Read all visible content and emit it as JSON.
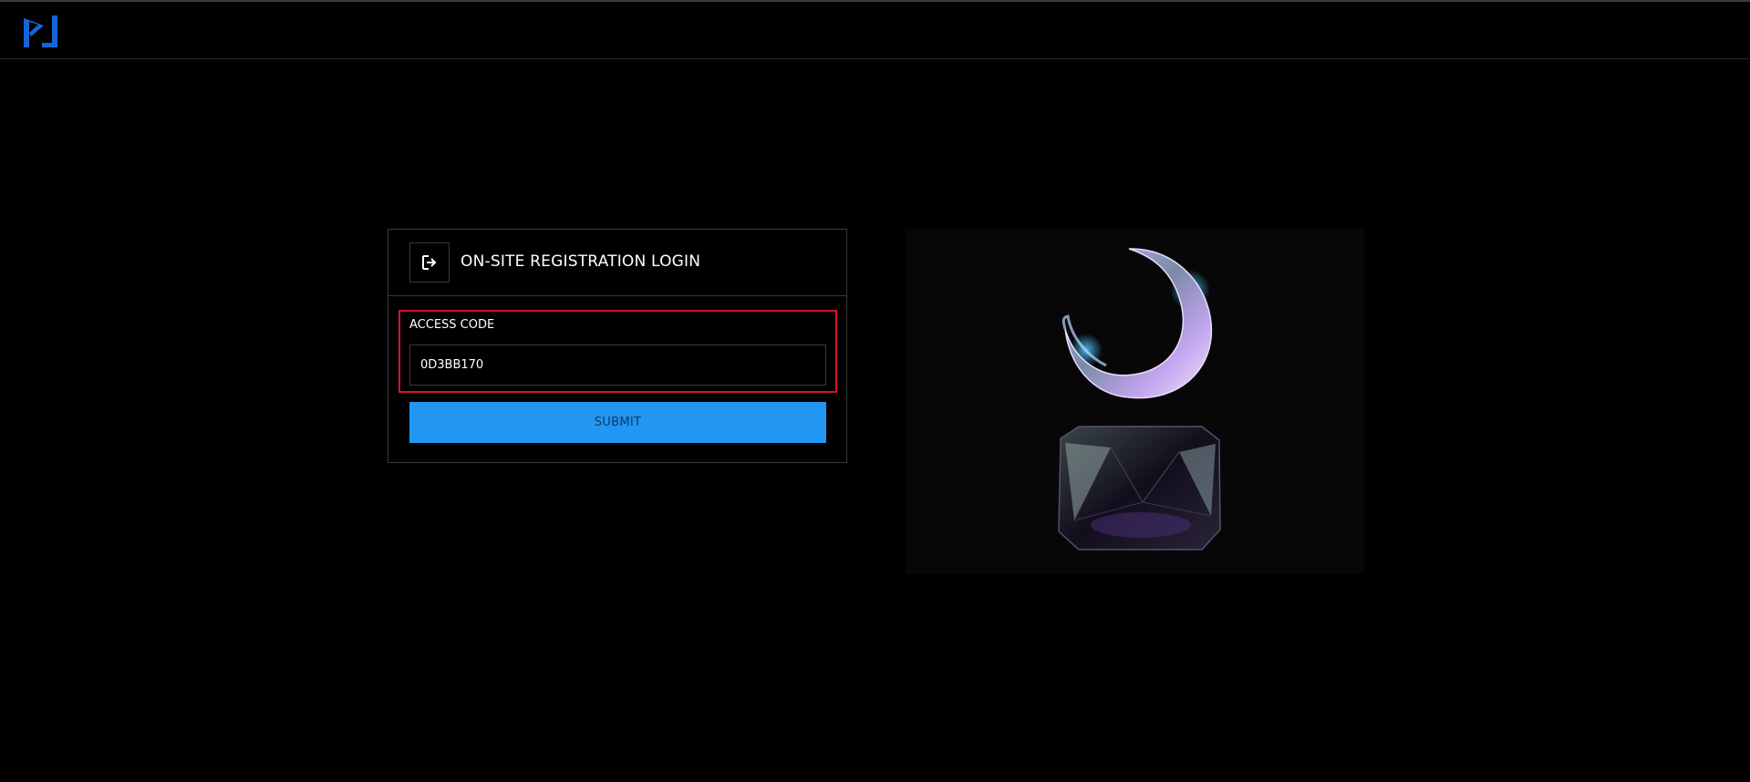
{
  "header": {
    "logo_icon": "pj-logo-icon",
    "brand_color": "#1565d8"
  },
  "login": {
    "icon": "sign-in-icon",
    "title": "ON-SITE REGISTRATION LOGIN",
    "access_code_label": "ACCESS CODE",
    "access_code_value": "0D3BB170",
    "submit_label": "SUBMIT",
    "submit_color": "#2196f3",
    "highlight_color": "#d7112e"
  },
  "hero": {
    "image": "crescent-moon-on-crystal-pedestal-image"
  }
}
